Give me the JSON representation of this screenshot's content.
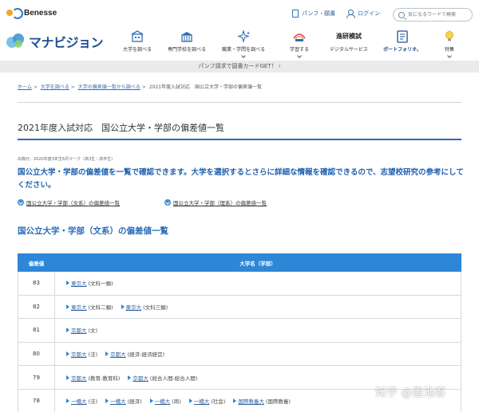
{
  "header": {
    "brand": "Benesse",
    "pamphlet_label": "パンフ・願書",
    "login_label": "ログイン",
    "search_placeholder": "気になるワードで検索"
  },
  "nav": {
    "logo_text": "マナビジョン",
    "items": [
      {
        "label": "大学を調べる",
        "icon": "university-building-icon"
      },
      {
        "label": "専門学校を調べる",
        "icon": "school-building-icon"
      },
      {
        "label": "職業・学問を調べる",
        "icon": "sparkle-icon"
      },
      {
        "label": "学習する",
        "icon": "rainbow-book-icon"
      },
      {
        "label": "進研模試",
        "sub": "デジタルサービス",
        "icon": "brand-text-icon"
      },
      {
        "label": "ポートフォリオ。",
        "icon": "portfolio-icon"
      },
      {
        "label": "特集",
        "icon": "lightbulb-icon"
      }
    ]
  },
  "promo": {
    "text": "パンフ請求で図書カードGET！ ›"
  },
  "breadcrumb": {
    "items": [
      "ホーム",
      "大学を調べる",
      "大学の偏差値一覧から調べる"
    ],
    "current": "2021年度入試対応　国公立大学・学部の偏差値一覧"
  },
  "page": {
    "title": "2021年度入試対応　国公立大学・学部の偏差値一覧",
    "source": "出典元：2020年度3年生6月マーク（高3生・高卒生）",
    "lead": "国公立大学・学部の偏差値を一覧で確認できます。大学を選択するとさらに詳細な情報を確認できるので、志望校研究の参考にしてください。",
    "anchor_humanities": "国公立大学・学部（文系）の偏差値一覧",
    "anchor_sciences": "国公立大学・学部（理系）の偏差値一覧",
    "section_title": "国公立大学・学部（文系）の偏差値一覧"
  },
  "table": {
    "col_score": "偏差値",
    "col_name": "大学名（学部）",
    "rows": [
      {
        "score": "83",
        "unis": [
          {
            "name": "東京大",
            "dept": "(文科一類)"
          }
        ]
      },
      {
        "score": "82",
        "unis": [
          {
            "name": "東京大",
            "dept": "(文科二類)"
          },
          {
            "name": "東京大",
            "dept": "(文科三類)"
          }
        ]
      },
      {
        "score": "81",
        "unis": [
          {
            "name": "京都大",
            "dept": "(文)"
          }
        ]
      },
      {
        "score": "80",
        "unis": [
          {
            "name": "京都大",
            "dept": "(法)"
          },
          {
            "name": "京都大",
            "dept": "(経済-経済経営)"
          }
        ]
      },
      {
        "score": "79",
        "unis": [
          {
            "name": "京都大",
            "dept": "(教育-教育科)"
          },
          {
            "name": "京都大",
            "dept": "(総合人間-総合人間)"
          }
        ]
      },
      {
        "score": "78",
        "unis": [
          {
            "name": "一橋大",
            "dept": "(法)"
          },
          {
            "name": "一橋大",
            "dept": "(経済)"
          },
          {
            "name": "一橋大",
            "dept": "(商)"
          },
          {
            "name": "一橋大",
            "dept": "(社会)"
          },
          {
            "name": "国際教養大",
            "dept": "(国際教養)"
          }
        ]
      }
    ]
  },
  "watermark": "知乎 @墨池客",
  "colors": {
    "accent": "#2e86d6",
    "heading": "#1f5fae",
    "promo_bg": "#e9eaec"
  }
}
